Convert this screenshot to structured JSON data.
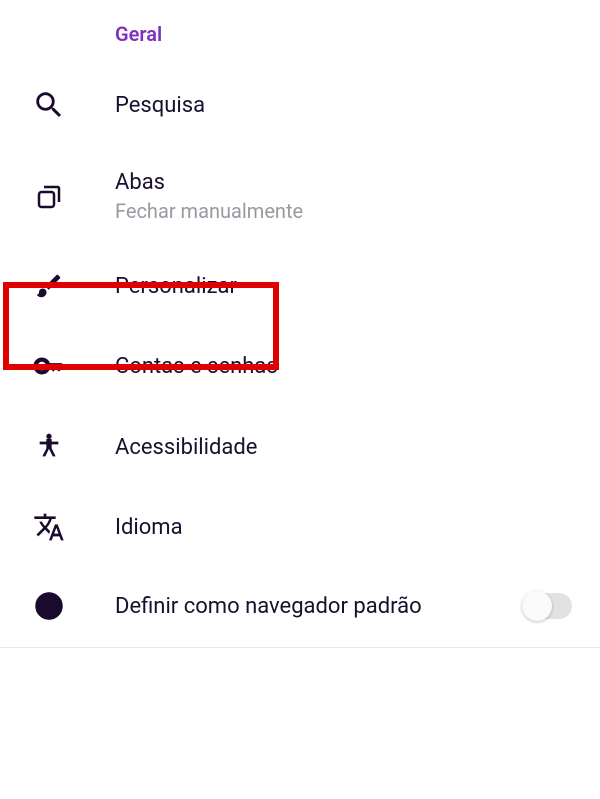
{
  "section": {
    "header": "Geral"
  },
  "items": {
    "search": {
      "label": "Pesquisa"
    },
    "tabs": {
      "label": "Abas",
      "sublabel": "Fechar manualmente"
    },
    "customize": {
      "label": "Personalizar"
    },
    "accounts": {
      "label": "Contas e senhas"
    },
    "accessibility": {
      "label": "Acessibilidade"
    },
    "language": {
      "label": "Idioma"
    },
    "default_browser": {
      "label": "Definir como navegador padrão",
      "enabled": false
    }
  },
  "colors": {
    "accent": "#8030c0",
    "highlight": "#e10000",
    "text": "#1a0f2e",
    "subtext": "#9a99a1"
  }
}
